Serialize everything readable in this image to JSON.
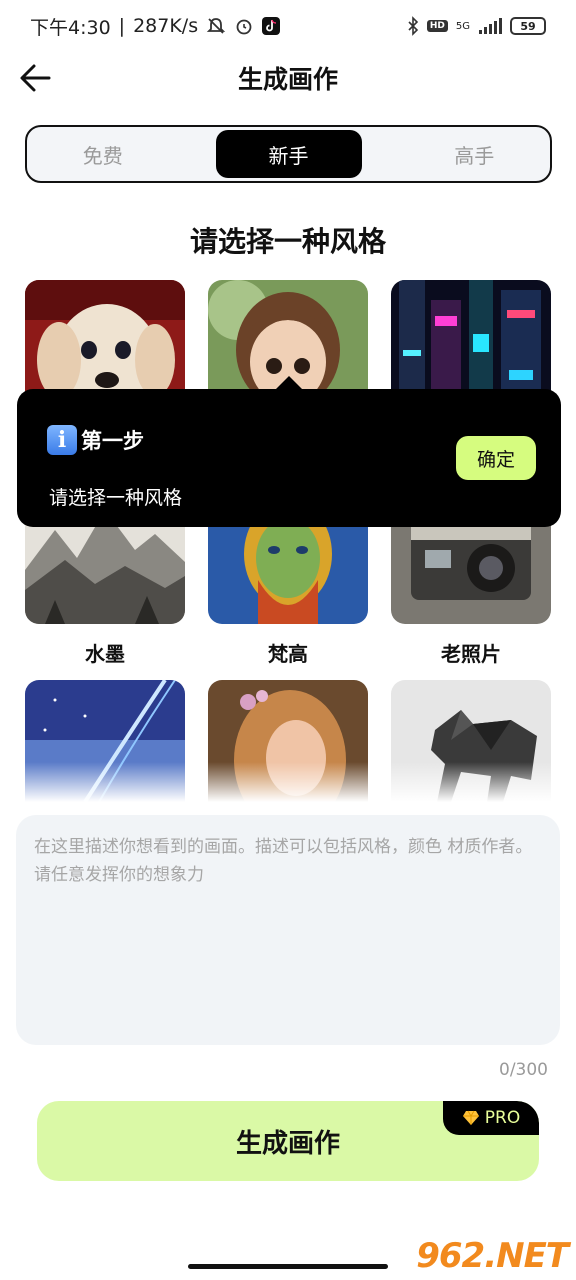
{
  "status_bar": {
    "time": "下午4:30",
    "speed": "287K/s",
    "signal": "5G",
    "hd": "HD",
    "battery": "59"
  },
  "header": {
    "title": "生成画作",
    "back_icon": "arrow-left-icon"
  },
  "tabs": [
    {
      "label": "免费",
      "active": false
    },
    {
      "label": "新手",
      "active": true
    },
    {
      "label": "高手",
      "active": false
    }
  ],
  "section_title": "请选择一种风格",
  "styles": [
    {
      "label": "",
      "image": "puppy-portrait"
    },
    {
      "label": "",
      "image": "cartoon-girl"
    },
    {
      "label": "",
      "image": "neon-cyberpunk-city"
    },
    {
      "label": "水墨",
      "image": "ink-landscape"
    },
    {
      "label": "梵高",
      "image": "van-gogh-portrait"
    },
    {
      "label": "老照片",
      "image": "vintage-camera"
    },
    {
      "label": "",
      "image": "anime-sky"
    },
    {
      "label": "",
      "image": "renaissance-woman"
    },
    {
      "label": "",
      "image": "origami-animal"
    }
  ],
  "tooltip": {
    "icon": "info-icon",
    "icon_glyph": "i",
    "title": "第一步",
    "desc": "请选择一种风格",
    "confirm": "确定"
  },
  "prompt": {
    "placeholder": "在这里描述你想看到的画面。描述可以包括风格，颜色 材质作者。请任意发挥你的想象力",
    "value": "",
    "count": "0/300"
  },
  "generate": {
    "label": "生成画作",
    "badge": "PRO",
    "badge_icon": "diamond-icon"
  },
  "watermark": "962.NET",
  "colors": {
    "accent": "#d6fc7f",
    "button_bg": "#daf9a6",
    "tab_active": "#000000"
  }
}
